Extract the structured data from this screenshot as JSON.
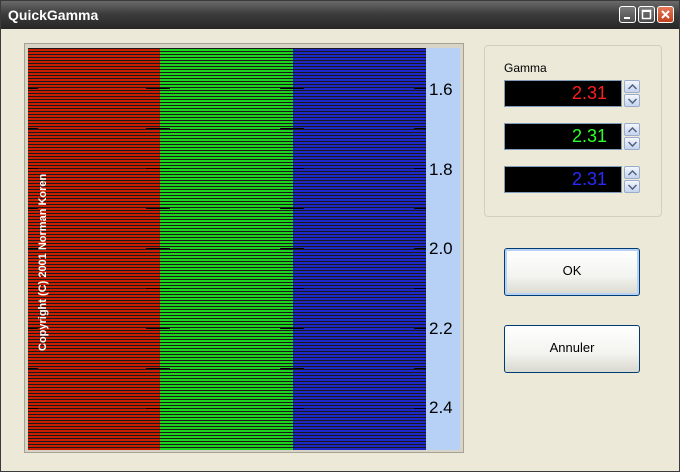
{
  "window": {
    "title": "QuickGamma"
  },
  "titlebar_buttons": [
    {
      "name": "minimize",
      "icon": "minimize-icon"
    },
    {
      "name": "maximize",
      "icon": "maximize-icon"
    },
    {
      "name": "close",
      "icon": "close-icon"
    }
  ],
  "pattern": {
    "copyright": "Copyright (C) 2001   Norman Koren",
    "scale_labels": [
      "1.6",
      "1.8",
      "2.0",
      "2.2",
      "2.4"
    ],
    "colors": {
      "red": "#c81e00",
      "green": "#1ed21e",
      "blue": "#1e28c8",
      "scale_bg": "#b7d0f5"
    }
  },
  "gamma": {
    "label": "Gamma",
    "values": [
      {
        "channel": "red",
        "value": "2.31",
        "color": "#ff1e1e"
      },
      {
        "channel": "green",
        "value": "2.31",
        "color": "#2dff2d"
      },
      {
        "channel": "blue",
        "value": "2.31",
        "color": "#2a2aff"
      }
    ]
  },
  "buttons": {
    "ok": "OK",
    "cancel": "Annuler"
  }
}
